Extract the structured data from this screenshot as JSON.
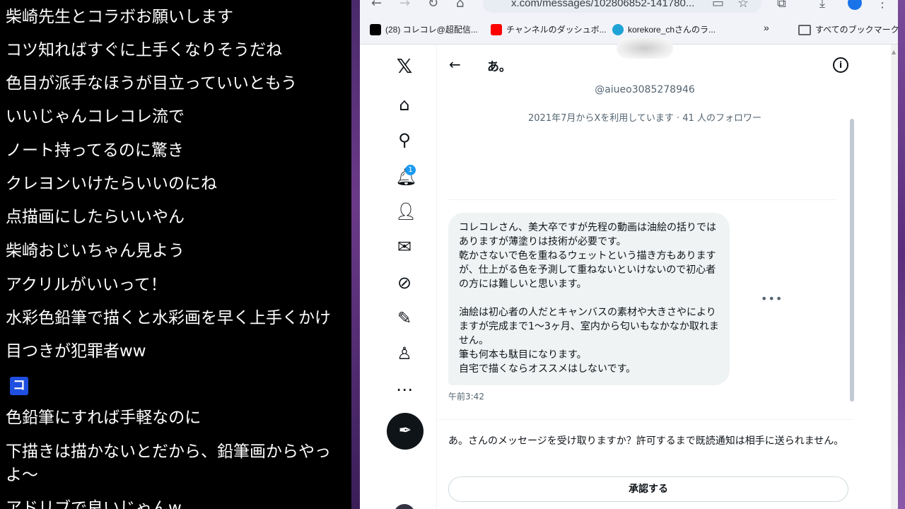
{
  "chat": {
    "messages": [
      "柴崎先生とコラボお願いします",
      "コツ知ればすぐに上手くなりそうだね",
      "色目が派手なほうが目立っていいともう",
      "いいじゃんコレコレ流で",
      "ノート持ってるのに驚き",
      "クレヨンいけたらいいのにね",
      "点描画にしたらいいやん",
      "柴崎おじいちゃん見よう",
      "アクリルがいいって！",
      "水彩色鉛筆で描くと水彩画を早く上手くかけ",
      "目つきが犯罪者ww",
      "色鉛筆にすれば手軽なのに",
      "下描きは描かないとだから、鉛筆画からやっ\nよ〜",
      "アドリブで良いじゃんw"
    ],
    "icon_glyph": "コ"
  },
  "browser": {
    "url": "x.com/messages/102806852-141780...",
    "bookmarks": [
      {
        "label": "(28) コレコレ@超配信...",
        "color": "#000000"
      },
      {
        "label": "チャンネルのダッシュボ...",
        "color": "#ff0000"
      },
      {
        "label": "korekore_chさんのラ...",
        "color": "#1fa3d6"
      }
    ],
    "bookmarks_more": "»",
    "all_bookmarks": "すべてのブックマーク"
  },
  "conversation": {
    "title": "あ。",
    "handle": "@aiueo3085278946",
    "joined": "2021年7月からXを利用しています · 41 人のフォロワー",
    "message": "コレコレさん、美大卒ですが先程の動画は油絵の括りでは\nありますが薄塗りは技術が必要です。\n乾かさないで色を重ねるウェットという描き方もあります\nが、仕上がる色を予測して重ねないといけないので初心者\nの方には難しいと思います。\n\n油絵は初心者の人だとキャンバスの素材や大きさやにより\nますが完成まで1〜3ヶ月、室内から匂いもなかなか取れま\nせん。\n筆も何本も駄目になります。\n自宅で描くならオススメはしないです。",
    "timestamp": "午前3:42",
    "request_text": "あ。さんのメッセージを受け取りますか？許可するまで既読通知は相手に送られません。",
    "accept_label": "承認する"
  },
  "nav": {
    "notification_count": "1"
  },
  "icons": [
    "x-logo-icon",
    "home-icon",
    "search-icon",
    "bell-icon",
    "add-person-icon",
    "mail-icon",
    "grok-icon",
    "edit-list-icon",
    "profile-icon",
    "more-circle-icon",
    "post-icon"
  ]
}
